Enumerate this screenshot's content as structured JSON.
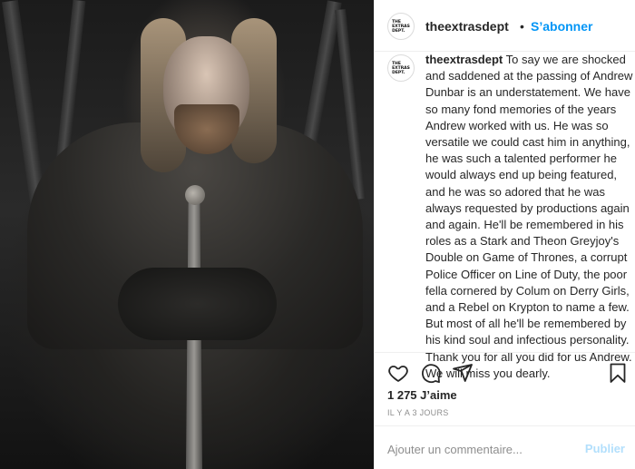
{
  "photo": {
    "alt": "Portrait of a bearded man in dark armor seated on an iron throne holding a sword"
  },
  "header": {
    "username": "theextrasdept",
    "separator": "•",
    "follow_label": "S’abonner",
    "avatar_text": "THE\nEXTRAS\nDEPT."
  },
  "caption": {
    "username": "theextrasdept",
    "avatar_text": "THE\nEXTRAS\nDEPT.",
    "text": " To say we are shocked and saddened at the passing of Andrew Dunbar is an understatement. We have so many fond memories of the years Andrew worked with us. He was so versatile we could cast him in anything, he was such a talented performer he would always end up being featured, and he was so adored that he was always requested by productions again and again. He'll be remembered in his roles as a Stark and Theon Greyjoy's Double on Game of Thrones, a corrupt Police Officer on Line of Duty, the poor fella cornered by Colum on Derry Girls, and a Rebel on Krypton to name a few. But most of all he'll be remembered by his kind soul and infectious personality.\nThank you for all you did for us Andrew. We will miss you dearly."
  },
  "actions": {
    "icons": [
      "heart-icon",
      "comment-icon",
      "share-icon",
      "bookmark-icon"
    ]
  },
  "likes": "1 275 J’aime",
  "timestamp": "IL Y A 3 JOURS",
  "comment": {
    "placeholder": "Ajouter un commentaire...",
    "publish_label": "Publier"
  },
  "colors": {
    "link_blue": "#0095f6",
    "publish_disabled": "#b2dffc",
    "text": "#262626",
    "muted": "#8e8e8e",
    "border": "#efefef"
  }
}
